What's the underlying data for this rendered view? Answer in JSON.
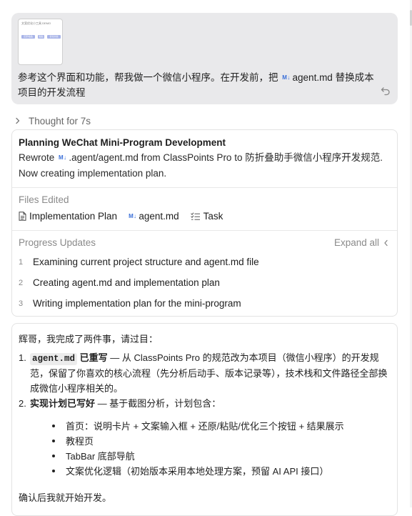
{
  "user_message": {
    "thumbnail": {
      "title": "文案优化小工具 DEMO",
      "buttons": [
        "还原/粘贴",
        "粘贴",
        "优化文案"
      ]
    },
    "text_before": "参考这个界面和功能，帮我做一个微信小程序。在开发前，把",
    "md_badge": "M↓",
    "file_name": "agent.md",
    "text_after": "替换成本项目的开发流程"
  },
  "thought": {
    "label": "Thought for 7s"
  },
  "plan_card": {
    "title": "Planning WeChat Mini-Program Development",
    "desc_prefix": "Rewrote",
    "md_badge": "M↓",
    "desc_file": ".agent/agent.md",
    "desc_suffix": "from ClassPoints Pro to 防折叠助手微信小程序开发规范.",
    "desc_line2": "Now creating implementation plan.",
    "files_label": "Files Edited",
    "files": [
      {
        "icon": "document-icon",
        "label": "Implementation Plan"
      },
      {
        "icon": "markdown-icon",
        "badge": "M↓",
        "label": "agent.md"
      },
      {
        "icon": "checklist-icon",
        "label": "Task"
      }
    ],
    "progress_label": "Progress Updates",
    "expand_label": "Expand all",
    "steps": [
      {
        "num": "1",
        "label": "Examining current project structure and agent.md file"
      },
      {
        "num": "2",
        "label": "Creating agent.md and implementation plan"
      },
      {
        "num": "3",
        "label": "Writing implementation plan for the mini-program"
      }
    ]
  },
  "response": {
    "greeting": "辉哥，我完成了两件事，请过目：",
    "item1": {
      "num": "1.",
      "code": "agent.md",
      "bold": "已重写",
      "line1": " — 从 ClassPoints Pro 的规范改为本项目（微信小程序）的开发规",
      "line2": "范，保留了你喜欢的核心流程（先分析后动手、版本记录等），技术栈和文件路径全部换",
      "line3": "成微信小程序相关的。"
    },
    "item2": {
      "num": "2.",
      "bold": "实现计划已写好",
      "text": " — 基于截图分析，计划包含："
    },
    "bullets": [
      "首页：说明卡片 + 文案输入框 + 还原/粘贴/优化三个按钮 + 结果展示",
      "教程页",
      "TabBar 底部导航",
      "文案优化逻辑（初始版本采用本地处理方案，预留 AI API 接口）"
    ],
    "closing": "确认后我就开始开发。"
  }
}
